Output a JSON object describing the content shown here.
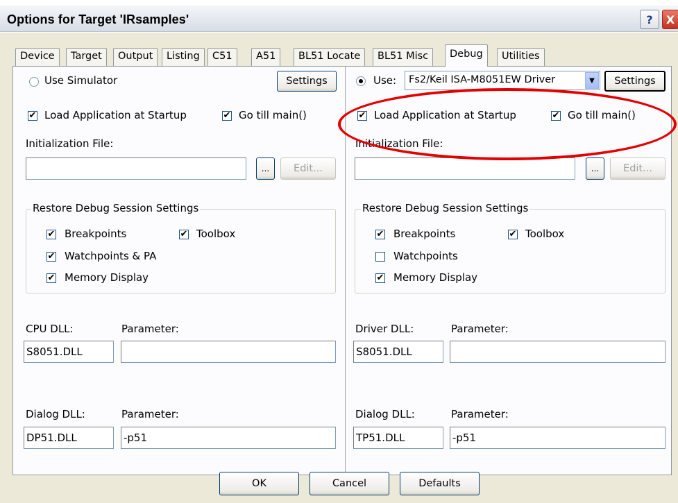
{
  "window": {
    "title": "Options for Target 'IRsamples'",
    "help_glyph": "?",
    "close_glyph": "X"
  },
  "tabs": [
    {
      "label": "Device",
      "active": false
    },
    {
      "label": "Target",
      "active": false
    },
    {
      "label": "Output",
      "active": false
    },
    {
      "label": "Listing",
      "active": false
    },
    {
      "label": "C51",
      "active": false
    },
    {
      "label": "A51",
      "active": false
    },
    {
      "label": "BL51 Locate",
      "active": false
    },
    {
      "label": "BL51 Misc",
      "active": false
    },
    {
      "label": "Debug",
      "active": true
    },
    {
      "label": "Utilities",
      "active": false
    }
  ],
  "left": {
    "use_simulator_label": "Use Simulator",
    "use_simulator_selected": false,
    "settings_button": "Settings",
    "load_app_label": "Load Application at Startup",
    "go_till_main_label": "Go  till main()",
    "init_file_label": "Initialization File:",
    "init_file_value": "",
    "browse_button": "...",
    "edit_button": "Edit...",
    "restore_group_label": "Restore Debug Session Settings",
    "breakpoints_label": "Breakpoints",
    "toolbox_label": "Toolbox",
    "watchpoints_label": "Watchpoints & PA",
    "memory_display_label": "Memory Display",
    "cpu_dll_label": "CPU DLL:",
    "cpu_dll_value": "S8051.DLL",
    "cpu_param_label": "Parameter:",
    "cpu_param_value": "",
    "dialog_dll_label": "Dialog DLL:",
    "dialog_dll_value": "DP51.DLL",
    "dialog_param_label": "Parameter:",
    "dialog_param_value": "-p51"
  },
  "right": {
    "use_label": "Use:",
    "use_selected": true,
    "driver_select_value": "Fs2/Keil ISA-M8051EW Driver",
    "settings_button": "Settings",
    "load_app_label": "Load Application at Startup",
    "go_till_main_label": "Go  till main()",
    "init_file_label": "Initialization File:",
    "init_file_value": "",
    "browse_button": "...",
    "edit_button": "Edit...",
    "restore_group_label": "Restore Debug Session Settings",
    "breakpoints_label": "Breakpoints",
    "toolbox_label": "Toolbox",
    "watchpoints_label": "Watchpoints",
    "memory_display_label": "Memory Display",
    "driver_dll_label": "Driver DLL:",
    "driver_dll_value": "S8051.DLL",
    "driver_param_label": "Parameter:",
    "driver_param_value": "",
    "dialog_dll_label": "Dialog DLL:",
    "dialog_dll_value": "TP51.DLL",
    "dialog_param_label": "Parameter:",
    "dialog_param_value": "-p51"
  },
  "checkboxes": {
    "left_load_app": true,
    "left_go_main": true,
    "left_breakpoints": true,
    "left_toolbox": true,
    "left_watchpoints": true,
    "left_memory": true,
    "right_load_app": true,
    "right_go_main": true,
    "right_breakpoints": true,
    "right_toolbox": true,
    "right_watchpoints": false,
    "right_memory": true
  },
  "footer": {
    "ok_button": "OK",
    "cancel_button": "Cancel",
    "defaults_button": "Defaults"
  },
  "colors": {
    "highlight": "#e30000",
    "dialog_bg": "#ece9d8"
  },
  "icons": {
    "check": "check-icon",
    "dropdown": "dropdown-arrow-icon"
  }
}
